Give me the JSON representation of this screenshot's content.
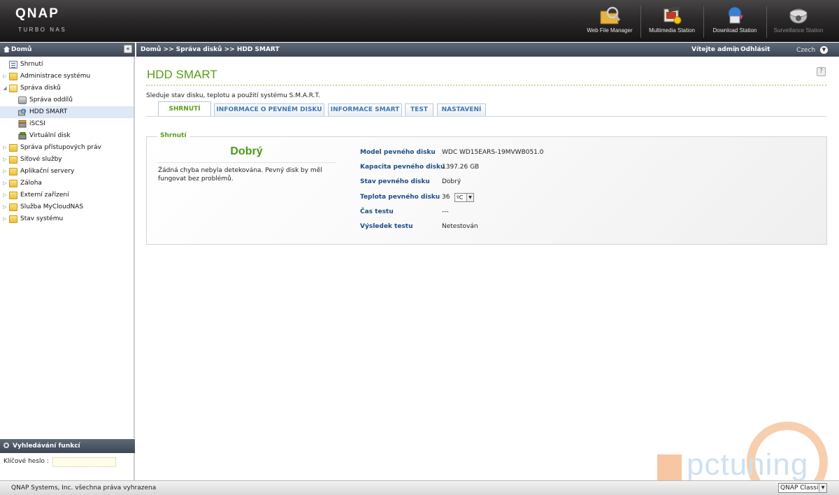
{
  "brand": {
    "logo": "QNAP",
    "subtitle": "TURBO NAS"
  },
  "apps": [
    {
      "label": "Web File Manager",
      "icon": "web-file-manager-icon"
    },
    {
      "label": "Multimedia Station",
      "icon": "multimedia-station-icon"
    },
    {
      "label": "Download Station",
      "icon": "download-station-icon"
    },
    {
      "label": "Surveillance Station",
      "icon": "surveillance-station-icon"
    }
  ],
  "sidebar": {
    "title": "Domů",
    "items": [
      {
        "label": "Shrnutí",
        "icon": "summary-icon"
      },
      {
        "label": "Administrace systému",
        "icon": "folder-icon"
      },
      {
        "label": "Správa disků",
        "icon": "folder-open-icon"
      },
      {
        "label": "Správa oddílů",
        "icon": "volume-management-icon"
      },
      {
        "label": "HDD SMART",
        "icon": "hdd-smart-icon"
      },
      {
        "label": "iSCSI",
        "icon": "iscsi-icon"
      },
      {
        "label": "Virtuální disk",
        "icon": "virtual-disk-icon"
      },
      {
        "label": "Správa přístupových práv",
        "icon": "folder-icon"
      },
      {
        "label": "Síťové služby",
        "icon": "folder-icon"
      },
      {
        "label": "Aplikační servery",
        "icon": "folder-icon"
      },
      {
        "label": "Záloha",
        "icon": "folder-icon"
      },
      {
        "label": "Externí zařízení",
        "icon": "folder-icon"
      },
      {
        "label": "Služba MyCloudNAS",
        "icon": "folder-icon"
      },
      {
        "label": "Stav systému",
        "icon": "folder-icon"
      }
    ],
    "search": {
      "title": "Vyhledávání funkcí",
      "label": "Klíčové heslo :",
      "value": ""
    }
  },
  "topbar": {
    "breadcrumb": "Domů >> Správa disků >> HDD SMART",
    "welcome": "Vítejte admin",
    "separator": "|",
    "logout": "Odhlásit",
    "language": "Czech"
  },
  "main": {
    "title": "HDD SMART",
    "description": "Sleduje stav disku, teplotu a použití systému S.M.A.R.T.",
    "tabs": [
      {
        "label": "SHRNUTÍ",
        "active": true
      },
      {
        "label": "INFORMACE O PEVNÉM DISKU",
        "active": false
      },
      {
        "label": "INFORMACE SMART",
        "active": false
      },
      {
        "label": "TEST",
        "active": false
      },
      {
        "label": "NASTAVENÍ",
        "active": false
      }
    ],
    "summary": {
      "legend": "Shrnutí",
      "status": "Dobrý",
      "message": "Žádná chyba nebyla detekována. Pevný disk by měl fungovat bez problémů.",
      "fields": [
        {
          "label": "Model pevného disku",
          "value": "WDC WD15EARS-19MVWB051.0"
        },
        {
          "label": "Kapacita pevného disku",
          "value": "1397.26 GB"
        },
        {
          "label": "Stav pevného disku",
          "value": "Dobrý"
        },
        {
          "label": "Teplota pevného disku",
          "value": "36"
        },
        {
          "label": "Čas testu",
          "value": "---"
        },
        {
          "label": "Výsledek testu",
          "value": "Netestován"
        }
      ],
      "temperature_unit": "ºC"
    }
  },
  "footer": {
    "copyright": "QNAP Systems, Inc. všechna práva vyhrazena",
    "theme": "QNAP Classic"
  },
  "watermark": {
    "text": "pctuning"
  },
  "colors": {
    "accent_green": "#5a9c19",
    "tab_blue": "#3a78b2",
    "label_blue": "#1d4c85"
  }
}
